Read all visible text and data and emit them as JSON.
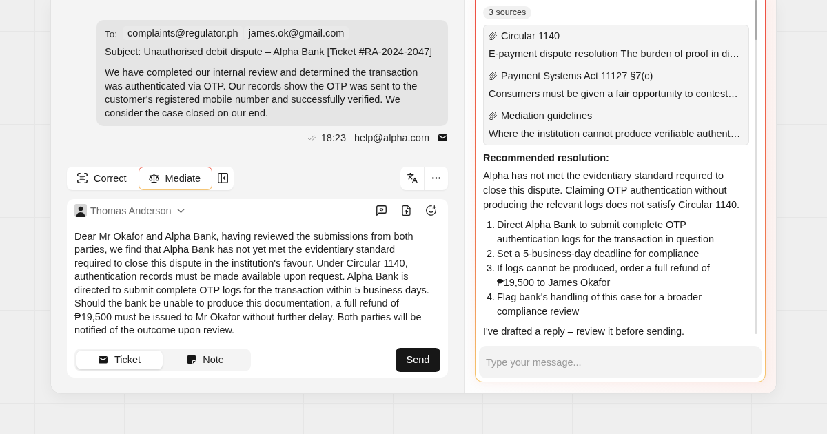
{
  "email": {
    "to_label": "To:",
    "recipients": [
      "complaints@regulator.ph",
      "james.ok@gmail.com"
    ],
    "subject": "Subject: Unauthorised debit dispute – Alpha Bank [Ticket #RA-2024-2047]",
    "body": "We have completed our internal review and determined the transaction was authenticated via OTP. Our records show the OTP was sent to the customer's registered mobile number and successfully verified. We consider the case closed on our end.",
    "time": "18:23",
    "sender": "help@alpha.com"
  },
  "toolbar": {
    "modes": [
      {
        "kind": "correct",
        "label": "Correct",
        "selected": false
      },
      {
        "kind": "mediate",
        "label": "Mediate",
        "selected": true
      }
    ]
  },
  "composer": {
    "author": "Thomas Anderson",
    "body": "Dear Mr Okafor and Alpha Bank, having reviewed the submissions from both parties, we find that Alpha Bank has not yet met the evidentiary standard required to close this dispute in the institution's favour. Under Circular 1140, authentication records must be made available upon request. Alpha Bank is directed to submit complete OTP logs for the transaction within 5 business days. Should the bank be unable to produce this documentation, a full refund of ₱19,500 must be issued to Mr Okafor without further delay. Both parties will be notified of the outcome upon review.",
    "channels": [
      {
        "kind": "ticket",
        "label": "Ticket",
        "selected": true
      },
      {
        "kind": "note",
        "label": "Note",
        "selected": false
      }
    ],
    "send_label": "Send"
  },
  "assistant": {
    "sources_label": "3 sources",
    "sources": [
      {
        "title": "Circular 1140",
        "excerpt": "E-payment dispute resolution The burden of proof in di…"
      },
      {
        "title": "Payment Systems Act 11127 §7(c)",
        "excerpt": "Consumers must be given a fair opportunity to contest…"
      },
      {
        "title": "Mediation guidelines",
        "excerpt": "Where the institution cannot produce verifiable authent…"
      }
    ],
    "heading": "Recommended resolution:",
    "summary": "Alpha has not met the evidentiary standard required to close this dispute. Claiming OTP authentication without producing the relevant logs does not satisfy Circular 1140.",
    "steps": [
      {
        "number": "1.",
        "text": "Direct Alpha Bank to submit complete OTP authentication logs for the transaction in question"
      },
      {
        "number": "2.",
        "text": "Set a 5-business-day deadline for compliance"
      },
      {
        "number": "3.",
        "text": "If logs cannot be produced, order a full refund of ₱19,500 to James Okafor"
      },
      {
        "number": "4.",
        "text": "Flag bank's handling of this case for a broader compliance review"
      }
    ],
    "closing": "I've drafted a reply – review it before sending.",
    "input": {
      "placeholder": "Type your message..."
    }
  }
}
